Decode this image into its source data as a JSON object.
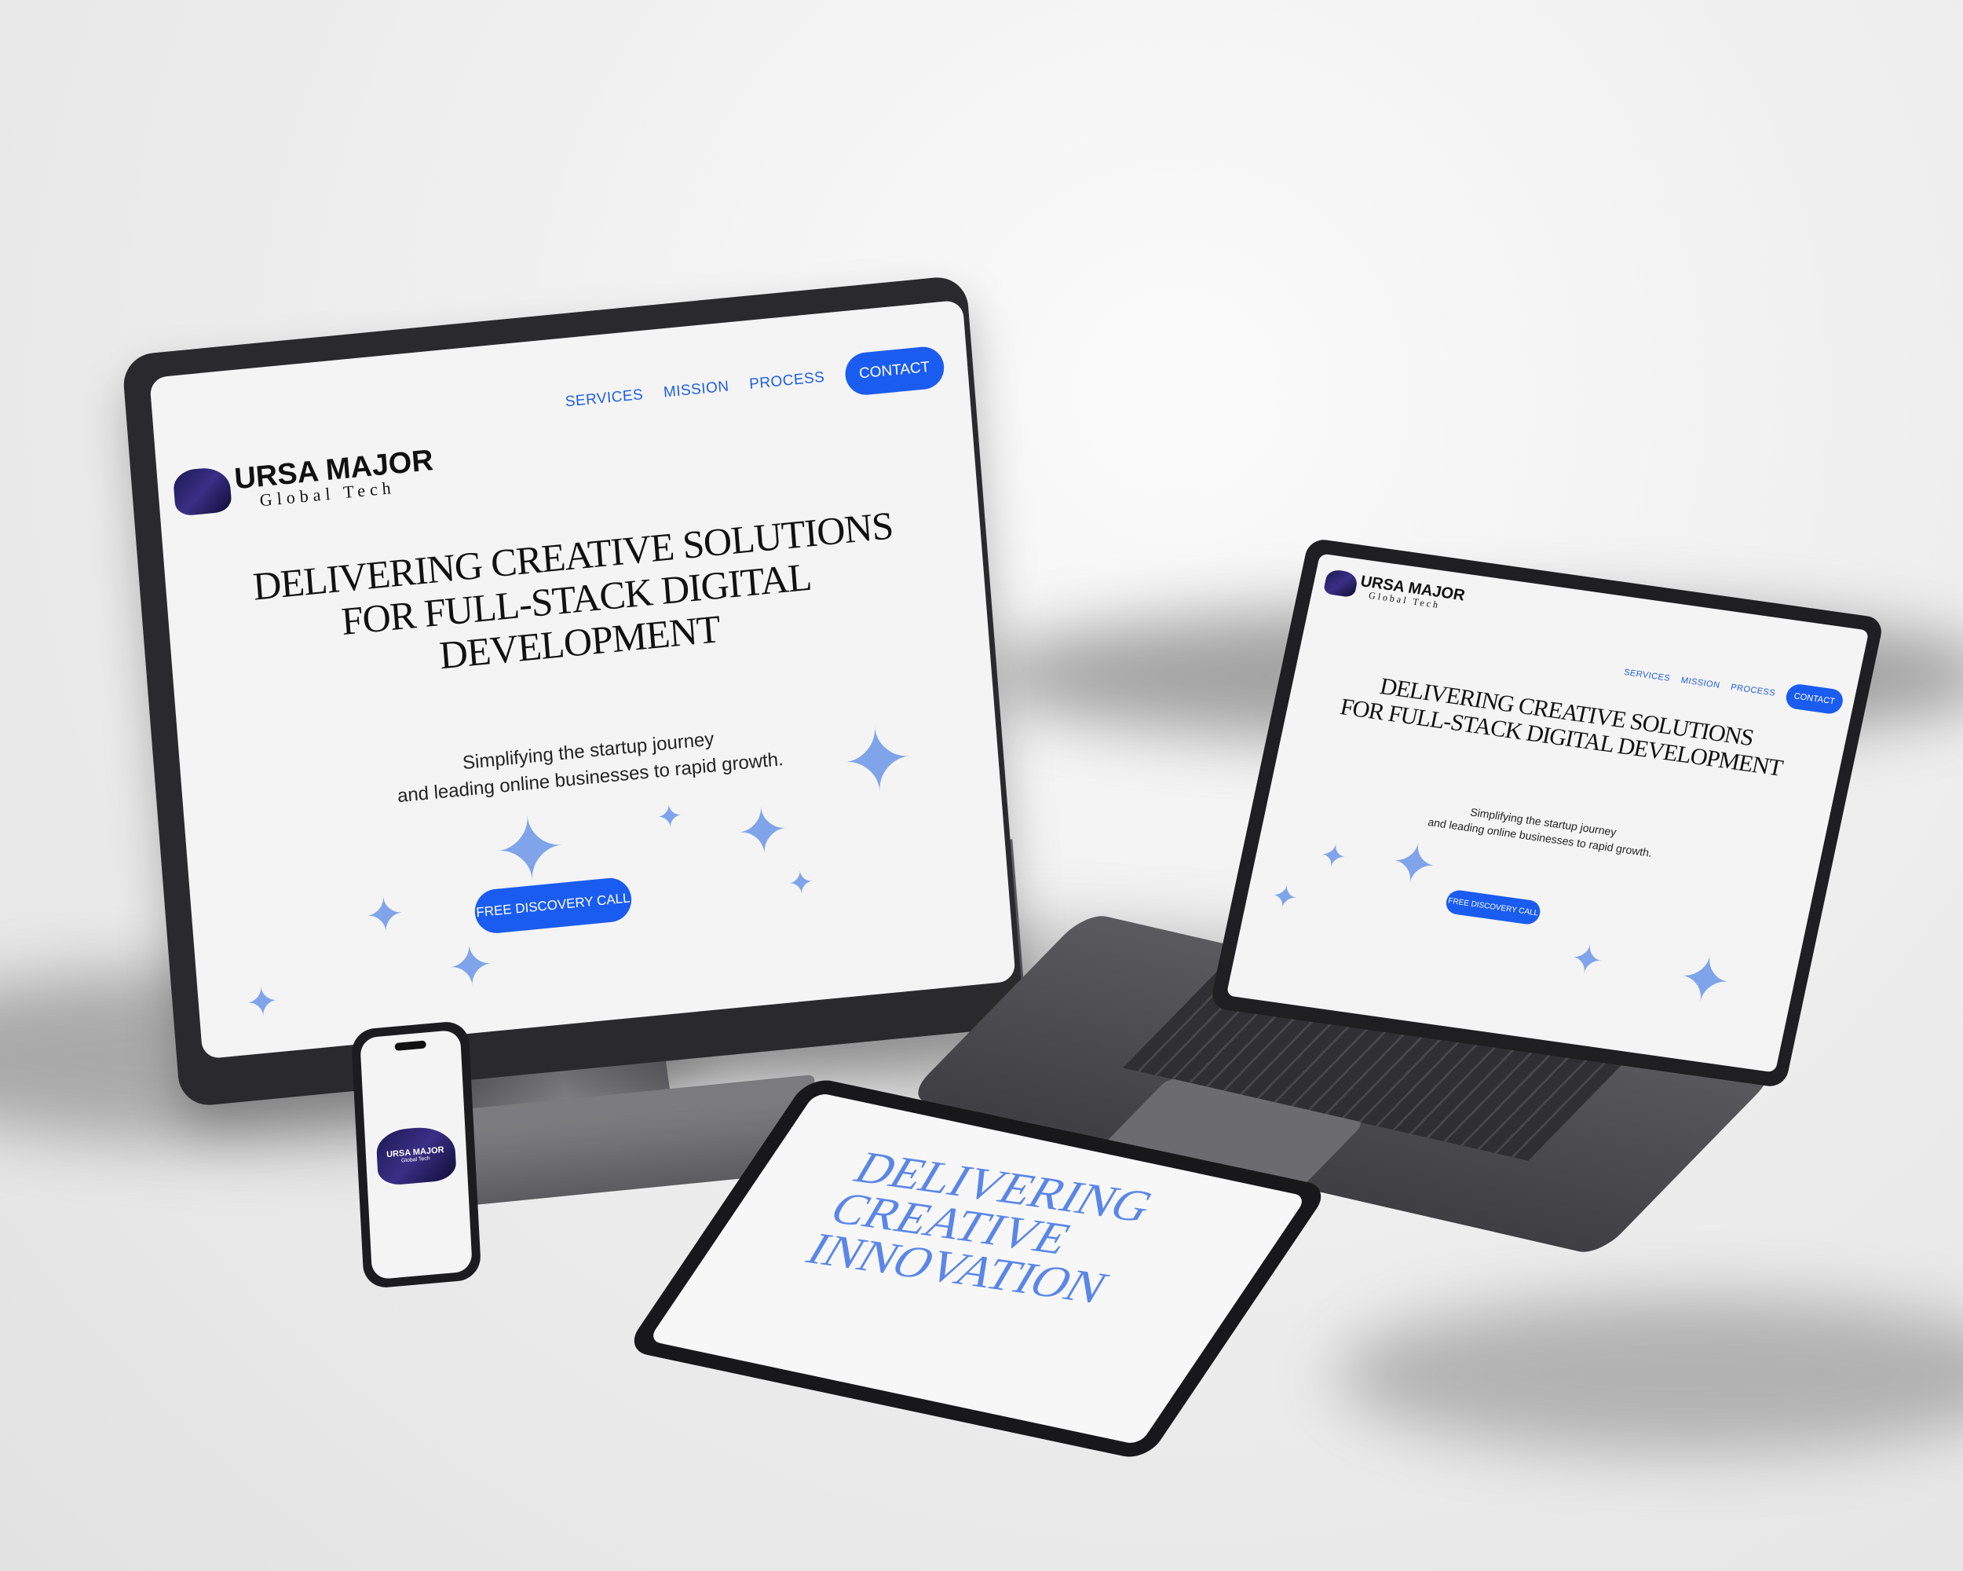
{
  "site": {
    "brand_title": "URSA MAJOR",
    "brand_subtitle": "Global Tech",
    "nav": [
      "SERVICES",
      "MISSION",
      "PROCESS"
    ],
    "contact_label": "CONTACT",
    "headline_line1": "DELIVERING  CREATIVE SOLUTIONS",
    "headline_line2": "FOR FULL-STACK DIGITAL DEVELOPMENT",
    "subtext_line1": "Simplifying the startup journey",
    "subtext_line2": "and leading online businesses to rapid growth.",
    "cta_label": "FREE DISCOVERY CALL"
  },
  "tablet": {
    "line1": "DELIVERING",
    "line2": "CREATIVE",
    "line3": "INNOVATION"
  },
  "phone": {
    "logo_line1": "URSA MAJOR",
    "logo_line2": "Global Tech"
  },
  "colors": {
    "accent": "#1a5cf0",
    "star": "#7fa4ea",
    "bear_dark": "#1c1a55"
  },
  "icons": {
    "logo": "bear-logo-icon",
    "decoration": "sparkle-star-icon"
  }
}
